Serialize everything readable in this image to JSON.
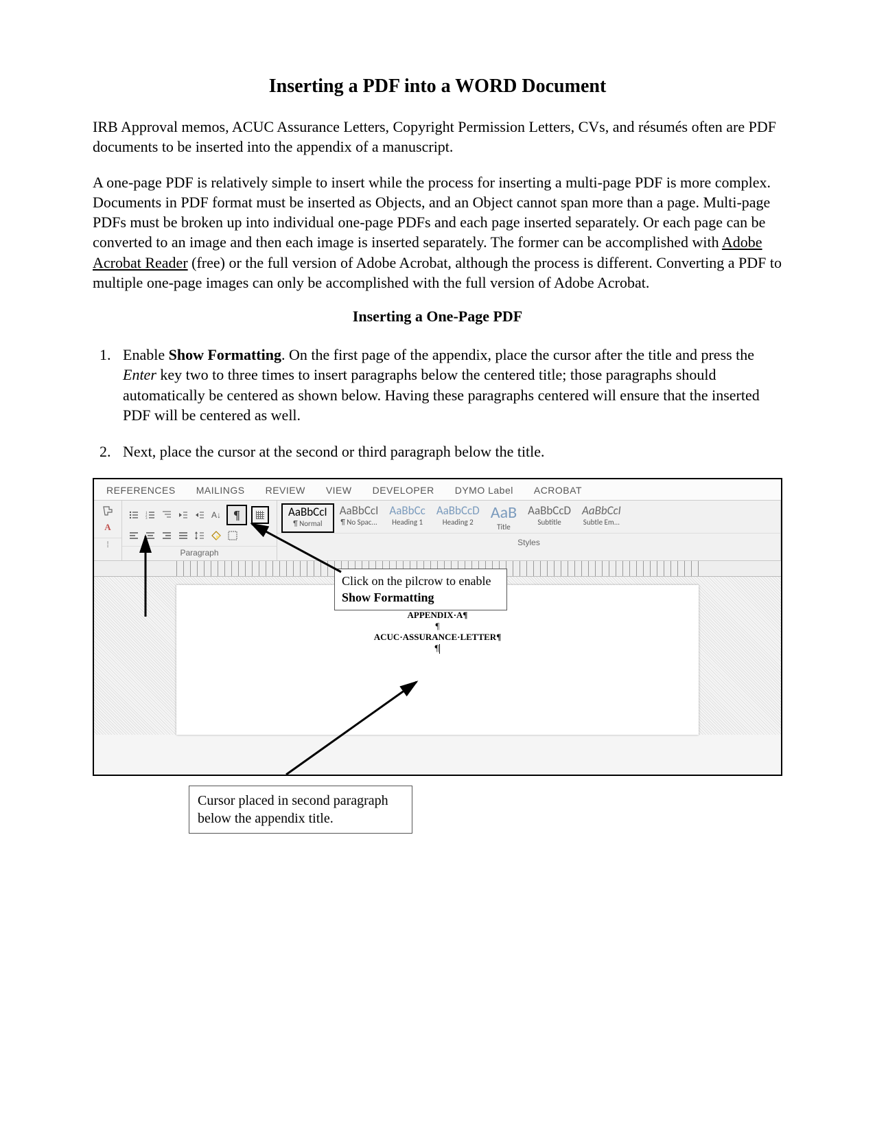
{
  "title": "Inserting a PDF into a WORD Document",
  "intro1": "IRB Approval memos, ACUC Assurance Letters, Copyright Permission Letters, CVs, and résumés often are PDF documents to be inserted into the appendix of a manuscript.",
  "intro2_pre": "A one-page PDF is relatively simple to insert while the process for inserting a multi-page PDF is more complex. Documents in PDF format must be inserted as Objects, and an Object cannot span more than a page. Multi-page PDFs must be broken up into individual one-page PDFs and each page inserted separately. Or each page can be converted to an image and then each image is inserted separately. The former can be accomplished with ",
  "intro2_link": "Adobe Acrobat Reader",
  "intro2_post": " (free) or the full version of Adobe Acrobat, although the process is different. Converting a PDF to multiple one-page images can only be accomplished with the full version of Adobe Acrobat.",
  "section_heading": "Inserting a One-Page PDF",
  "step1_a": "Enable ",
  "step1_b_bold": "Show Formatting",
  "step1_c": ". On the first page of the appendix, place the cursor after the title and press the ",
  "step1_d_italic": "Enter",
  "step1_e": " key two to three times to insert paragraphs below the centered title; those paragraphs should automatically be centered as shown below. Having these paragraphs centered will ensure that the inserted PDF will be centered as well.",
  "step2": "Next, place the cursor at the second or third paragraph below the title.",
  "tabs": [
    "REFERENCES",
    "MAILINGS",
    "REVIEW",
    "VIEW",
    "DEVELOPER",
    "DYMO Label",
    "ACROBAT"
  ],
  "ribbon_group1_label": "Paragraph",
  "styles_label": "Styles",
  "style_items": [
    {
      "preview": "AaBbCcI",
      "name": "¶ Normal",
      "cls": "normal",
      "selected": true
    },
    {
      "preview": "AaBbCcI",
      "name": "¶ No Spac...",
      "cls": ""
    },
    {
      "preview": "AaBbCc",
      "name": "Heading 1",
      "cls": "h1"
    },
    {
      "preview": "AaBbCcD",
      "name": "Heading 2",
      "cls": "h2"
    },
    {
      "preview": "AaB",
      "name": "Title",
      "cls": "big"
    },
    {
      "preview": "AaBbCcD",
      "name": "Subtitle",
      "cls": ""
    },
    {
      "preview": "AaBbCcI",
      "name": "Subtle Em...",
      "cls": "italic-prev"
    }
  ],
  "doc_line1": "APPENDIX·A¶",
  "doc_line2": "¶",
  "doc_line3": "ACUC·ASSURANCE·LETTER¶",
  "doc_line4": "¶",
  "callout1_a": "Click on the pilcrow to enable ",
  "callout1_b_bold": "Show Formatting",
  "callout2": "Cursor placed in second paragraph below the appendix title."
}
